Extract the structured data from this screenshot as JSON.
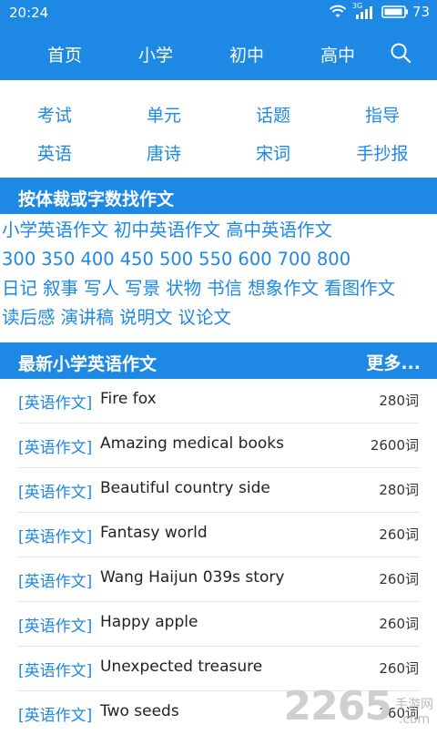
{
  "status": {
    "time": "20:24",
    "battery": "73",
    "network": "3G"
  },
  "nav": {
    "items": [
      "首页",
      "小学",
      "初中",
      "高中"
    ]
  },
  "categories": {
    "row1": [
      "考试",
      "单元",
      "话题",
      "指导"
    ],
    "row2": [
      "英语",
      "唐诗",
      "宋词",
      "手抄报"
    ]
  },
  "find_section": {
    "title": "按体裁或字数找作文",
    "levels": [
      "小学英语作文",
      "初中英语作文",
      "高中英语作文"
    ],
    "counts": [
      "300",
      "350",
      "400",
      "450",
      "500",
      "550",
      "600",
      "700",
      "800"
    ],
    "genres1": [
      "日记",
      "叙事",
      "写人",
      "写景",
      "状物",
      "书信",
      "想象作文",
      "看图作文"
    ],
    "genres2": [
      "读后感",
      "演讲稿",
      "说明文",
      "议论文"
    ]
  },
  "latest": {
    "title": "最新小学英语作文",
    "more": "更多...",
    "items": [
      {
        "tag": "[英语作文]",
        "name": "Fire fox",
        "count": "280词"
      },
      {
        "tag": "[英语作文]",
        "name": "Amazing medical books",
        "count": "2600词"
      },
      {
        "tag": "[英语作文]",
        "name": "Beautiful country side",
        "count": "280词"
      },
      {
        "tag": "[英语作文]",
        "name": "Fantasy world",
        "count": "260词"
      },
      {
        "tag": "[英语作文]",
        "name": "Wang Haijun 039s story",
        "count": "260词"
      },
      {
        "tag": "[英语作文]",
        "name": "Happy apple",
        "count": "260词"
      },
      {
        "tag": "[英语作文]",
        "name": "Unexpected treasure",
        "count": "260词"
      },
      {
        "tag": "[英语作文]",
        "name": "Two seeds",
        "count": "260词"
      }
    ]
  },
  "watermark": {
    "number": "2265",
    "text1": "手游网",
    "text2": ".com"
  },
  "colors": {
    "primary": "#1e88e5",
    "text": "#222222",
    "divider": "#e6e6e6"
  }
}
